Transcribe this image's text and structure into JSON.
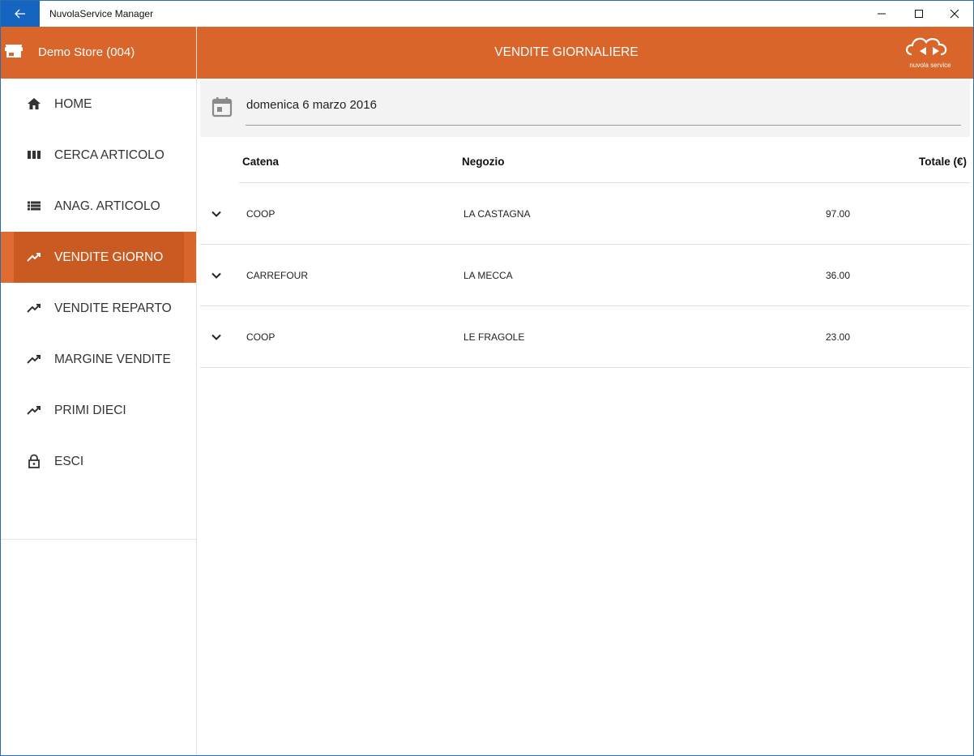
{
  "window": {
    "title": "NuvolaService Manager"
  },
  "sidebar": {
    "store_name": "Demo Store (004)",
    "items": [
      {
        "label": "HOME",
        "icon": "home-icon",
        "active": false
      },
      {
        "label": "CERCA ARTICOLO",
        "icon": "barcode-icon",
        "active": false
      },
      {
        "label": "ANAG. ARTICOLO",
        "icon": "list-icon",
        "active": false
      },
      {
        "label": "VENDITE GIORNO",
        "icon": "trending-up-icon",
        "active": true
      },
      {
        "label": "VENDITE REPARTO",
        "icon": "trending-up-icon",
        "active": false
      },
      {
        "label": "MARGINE VENDITE",
        "icon": "trending-up-icon",
        "active": false
      },
      {
        "label": "PRIMI DIECI",
        "icon": "trending-up-icon",
        "active": false
      },
      {
        "label": "ESCI",
        "icon": "lock-icon",
        "active": false
      }
    ]
  },
  "header": {
    "title": "VENDITE GIORNALIERE",
    "logo_text": "nuvola service"
  },
  "date_filter": {
    "value": "domenica 6 marzo 2016"
  },
  "table": {
    "columns": [
      "Catena",
      "Negozio",
      "Totale (€)"
    ],
    "rows": [
      {
        "catena": "COOP",
        "negozio": "LA CASTAGNA",
        "totale": "97.00"
      },
      {
        "catena": "CARREFOUR",
        "negozio": "LA MECCA",
        "totale": "36.00"
      },
      {
        "catena": "COOP",
        "negozio": "LE FRAGOLE",
        "totale": "23.00"
      }
    ]
  },
  "colors": {
    "accent": "#d9652a",
    "accent_active": "#c95a22",
    "titlebar_back": "#1565c0"
  }
}
